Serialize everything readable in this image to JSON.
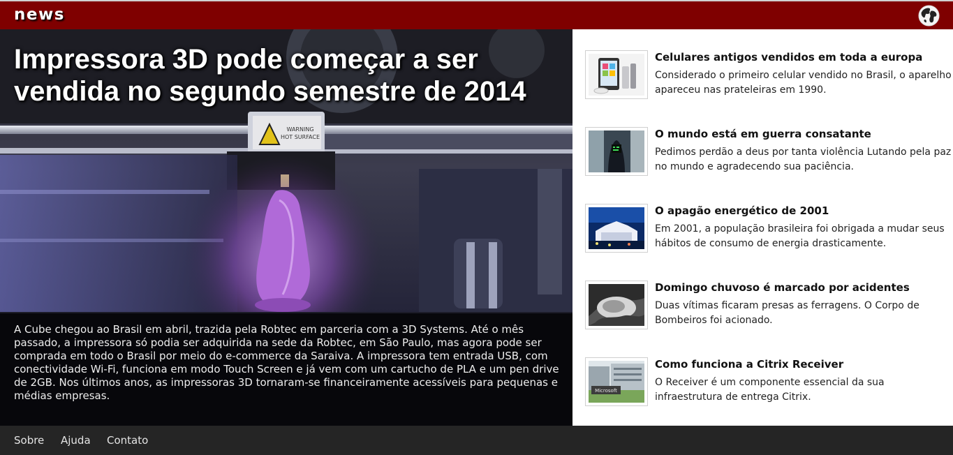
{
  "header": {
    "brand": "news",
    "globe_icon": "globe-icon",
    "colors": {
      "bar": "#7f0000",
      "footer": "#252525"
    }
  },
  "hero": {
    "title": "Impressora 3D pode começar a ser vendida no segundo semestre de 2014",
    "caption": "A Cube chegou ao Brasil em abril, trazida pela Robtec em parceria com a 3D Systems. Até o mês passado, a impressora só podia ser adquirida na sede da Robtec, em São Paulo, mas agora pode ser comprada em todo o Brasil por meio do e-commerce da Saraiva. A impressora tem entrada USB, com conectividade Wi-Fi, funciona em modo Touch Screen e já vem com um cartucho de PLA e um pen drive de 2GB. Nos últimos anos, as impressoras 3D tornaram-se financeiramente acessíveis para pequenas e médias empresas.",
    "image_warning": "WARNING HOT SURFACE"
  },
  "news": [
    {
      "title": "Celulares antigos vendidos em toda a europa",
      "desc": "Considerado o primeiro celular vendido no Brasil, o aparelho apareceu nas prateleiras em 1990."
    },
    {
      "title": "O mundo está em guerra consatante",
      "desc": "Pedimos perdão a deus por tanta violência Lutando pela paz no mundo e agradecendo sua paciência."
    },
    {
      "title": "O apagão energético de 2001",
      "desc": "Em 2001, a população brasileira foi obrigada a mudar seus hábitos de consumo de energia drasticamente."
    },
    {
      "title": "Domingo chuvoso é marcado por acidentes",
      "desc": "Duas vítimas ficaram presas as ferragens. O Corpo de Bombeiros foi acionado."
    },
    {
      "title": "Como funciona a Citrix Receiver",
      "desc": "O Receiver é um componente essencial da sua infraestrutura de entrega Citrix.",
      "thumb_sign": "Microsoft"
    }
  ],
  "footer": {
    "links": [
      "Sobre",
      "Ajuda",
      "Contato"
    ]
  }
}
